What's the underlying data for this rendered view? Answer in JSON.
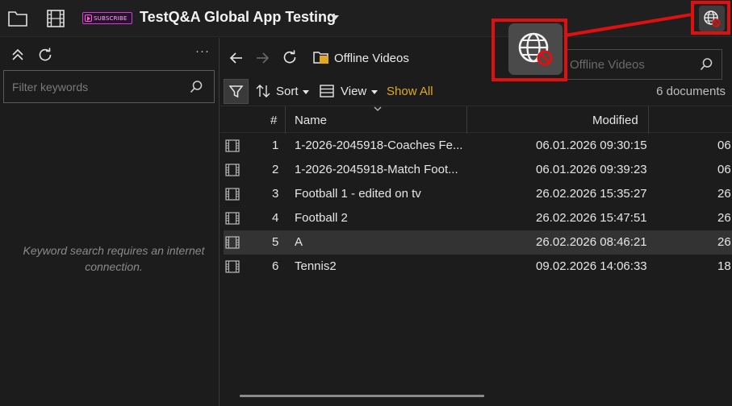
{
  "topbar": {
    "brand_badge_text": "SUBSCRIBE",
    "app_title": "TestQ&A Global App Testing",
    "icons": [
      "folder-icon",
      "film-icon",
      "chevron-down-icon",
      "globe-offline-icon"
    ]
  },
  "left": {
    "filter_placeholder": "Filter keywords",
    "more_label": "···",
    "no_connection_text": "Keyword search requires an internet connection."
  },
  "right": {
    "path_label": "Offline Videos",
    "search_placeholder": "Offline Videos",
    "toolbar": {
      "sort_label": "Sort",
      "view_label": "View",
      "show_all_label": "Show All",
      "doc_count": "6 documents"
    },
    "columns": [
      "#",
      "Name",
      "Modified"
    ],
    "rows": [
      {
        "num": "1",
        "name": "1-2026-2045918-Coaches Fe...",
        "modified": "06.01.2026 09:30:15",
        "extra": "06"
      },
      {
        "num": "2",
        "name": "1-2026-2045918-Match Foot...",
        "modified": "06.01.2026 09:39:23",
        "extra": "06"
      },
      {
        "num": "3",
        "name": "Football 1 - edited on tv",
        "modified": "26.02.2026 15:35:27",
        "extra": "26"
      },
      {
        "num": "4",
        "name": "Football 2",
        "modified": "26.02.2026 15:47:51",
        "extra": "26"
      },
      {
        "num": "5",
        "name": "A",
        "modified": "26.02.2026 08:46:21",
        "extra": "26"
      },
      {
        "num": "6",
        "name": "Tennis2",
        "modified": "09.02.2026 14:06:33",
        "extra": "18"
      }
    ]
  },
  "colors": {
    "accent": "#e3a822",
    "highlight": "#e01010",
    "background": "#1c1c1c"
  }
}
